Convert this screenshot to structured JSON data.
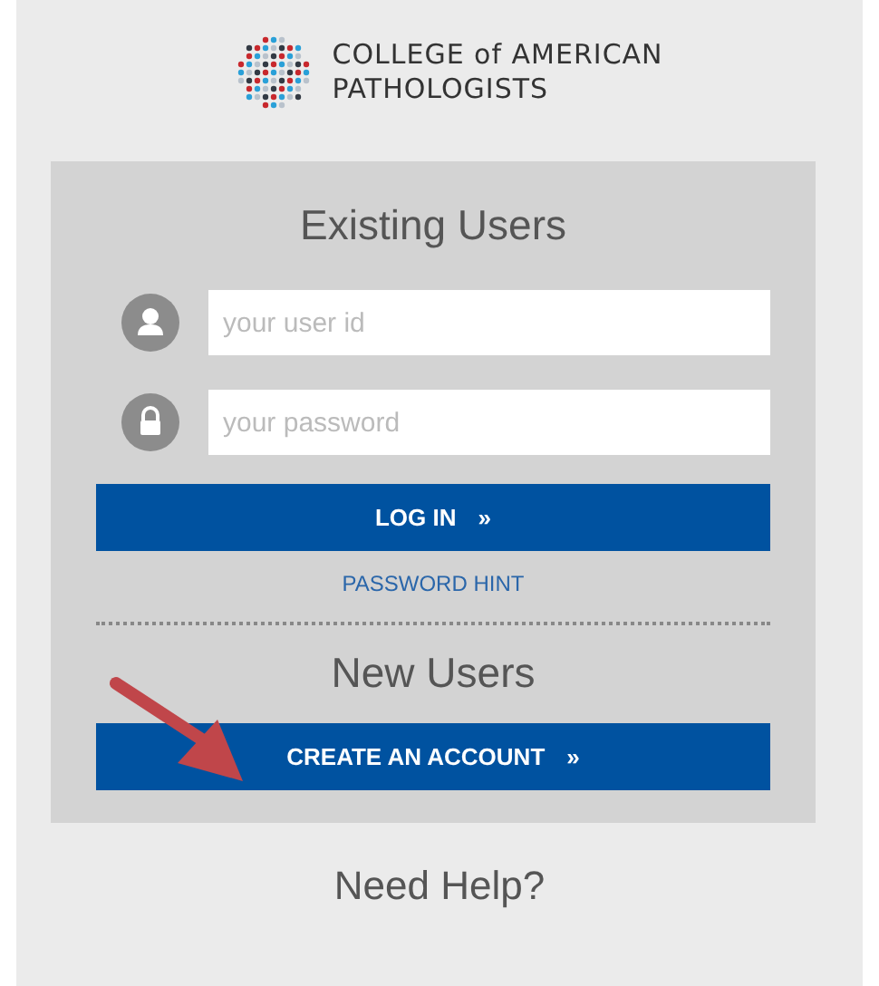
{
  "logo": {
    "line_1": "COLLEGE of AMERICAN",
    "line_2": "PATHOLOGISTS"
  },
  "existing_users": {
    "heading": "Existing Users",
    "fields": [
      {
        "kind": "user",
        "placeholder": "your user id"
      },
      {
        "kind": "lock",
        "placeholder": "your password"
      }
    ],
    "login_button": {
      "label": "LOG IN",
      "chevron": "»"
    },
    "hint_link": "PASSWORD HINT"
  },
  "new_users": {
    "heading": "New Users",
    "create_button": {
      "label": "CREATE AN ACCOUNT",
      "chevron": "»"
    }
  },
  "help": {
    "heading": "Need Help?"
  }
}
